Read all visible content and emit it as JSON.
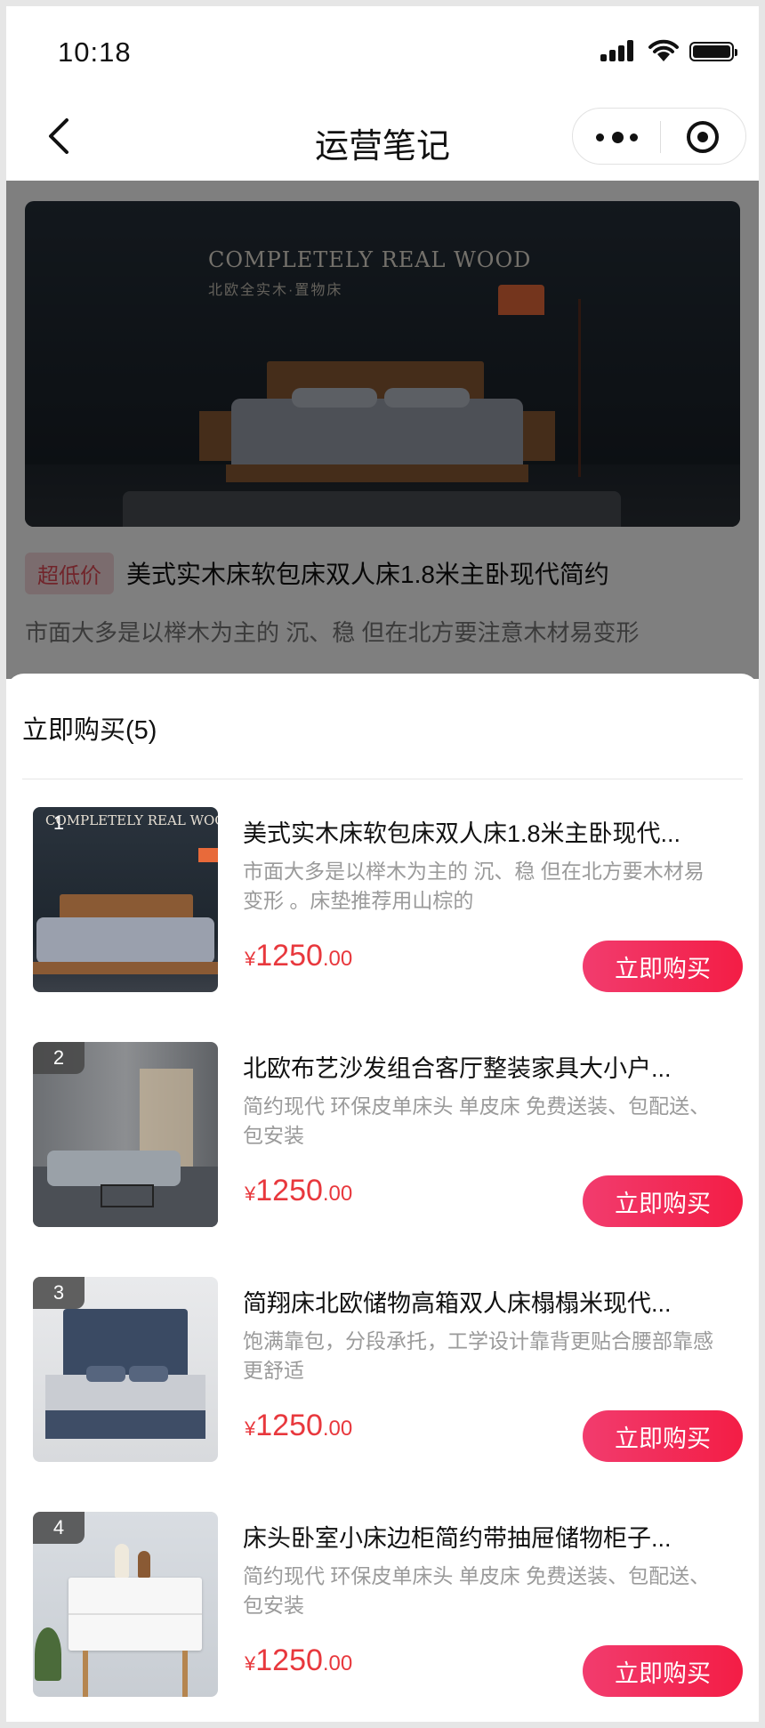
{
  "status_bar": {
    "time": "10:18"
  },
  "nav": {
    "title": "运营笔记"
  },
  "banner": {
    "headline": "COMPLETELY REAL WOOD",
    "subtitle": "北欧全实木·置物床",
    "tag": "超低价",
    "title": "美式实木床软包床双人床1.8米主卧现代简约",
    "description": "市面大多是以榉木为主的 沉、稳 但在北方要注意木材易变形"
  },
  "sheet": {
    "title": "立即购买(5)",
    "buy_label": "立即购买",
    "items": [
      {
        "index": "1",
        "name": "美式实木床软包床双人床1.8米主卧现代...",
        "desc": "市面大多是以榉木为主的 沉、稳 但在北方要木材易变形 。床垫推荐用山棕的",
        "currency": "¥",
        "price_int": "1250",
        "price_dec": ".00"
      },
      {
        "index": "2",
        "name": "北欧布艺沙发组合客厅整装家具大小户...",
        "desc": "简约现代 环保皮单床头 单皮床 免费送装、包配送、包安装",
        "currency": "¥",
        "price_int": "1250",
        "price_dec": ".00"
      },
      {
        "index": "3",
        "name": "简翔床北欧储物高箱双人床榻榻米现代...",
        "desc": "饱满靠包，分段承托，工学设计靠背更贴合腰部靠感更舒适",
        "currency": "¥",
        "price_int": "1250",
        "price_dec": ".00"
      },
      {
        "index": "4",
        "name": "床头卧室小床边柜简约带抽屉储物柜子...",
        "desc": "简约现代 环保皮单床头 单皮床 免费送装、包配送、包安装",
        "currency": "¥",
        "price_int": "1250",
        "price_dec": ".00"
      }
    ]
  },
  "colors": {
    "accent": "#f31d45",
    "price": "#e8383d",
    "tag_bg": "#f7d9dc",
    "tag_text": "#e24b57"
  }
}
